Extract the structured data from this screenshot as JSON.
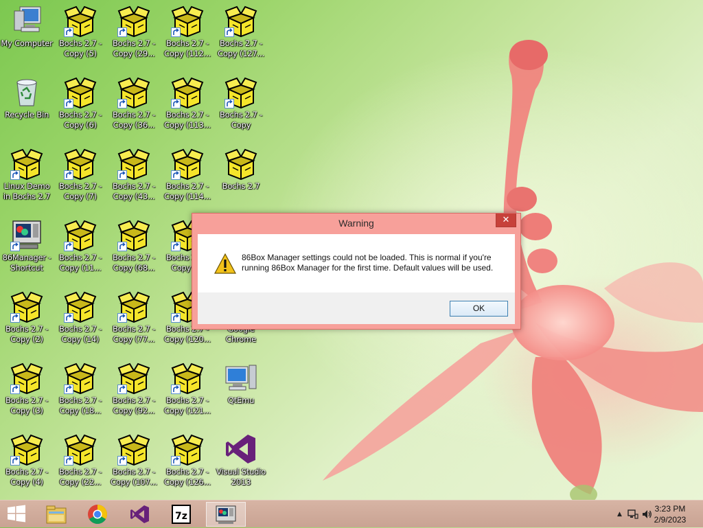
{
  "desktop": {
    "icons": [
      {
        "label": "My Computer",
        "type": "computer",
        "shortcut": false
      },
      {
        "label": "Bochs 2.7 -\nCopy (5)",
        "type": "bochs",
        "shortcut": true
      },
      {
        "label": "Bochs 2.7 -\nCopy (29...",
        "type": "bochs",
        "shortcut": true
      },
      {
        "label": "Bochs 2.7 -\nCopy (112...",
        "type": "bochs",
        "shortcut": true
      },
      {
        "label": "Bochs 2.7 -\nCopy (127...",
        "type": "bochs",
        "shortcut": true
      },
      {
        "label": "Recycle Bin",
        "type": "recycle",
        "shortcut": false
      },
      {
        "label": "Bochs 2.7 -\nCopy (6)",
        "type": "bochs",
        "shortcut": true
      },
      {
        "label": "Bochs 2.7 -\nCopy (36...",
        "type": "bochs",
        "shortcut": true
      },
      {
        "label": "Bochs 2.7 -\nCopy (113...",
        "type": "bochs",
        "shortcut": true
      },
      {
        "label": "Bochs 2.7 -\nCopy",
        "type": "bochs",
        "shortcut": true
      },
      {
        "label": "Linux Demo\nin Bochs 2.7",
        "type": "bochs",
        "shortcut": true
      },
      {
        "label": "Bochs 2.7 -\nCopy (7)",
        "type": "bochs",
        "shortcut": true
      },
      {
        "label": "Bochs 2.7 -\nCopy (43...",
        "type": "bochs",
        "shortcut": true
      },
      {
        "label": "Bochs 2.7 -\nCopy (114...",
        "type": "bochs",
        "shortcut": true
      },
      {
        "label": "Bochs 2.7",
        "type": "bochs",
        "shortcut": false
      },
      {
        "label": "86Manager -\nShortcut",
        "type": "manager",
        "shortcut": true
      },
      {
        "label": "Bochs 2.7 -\nCopy (11...",
        "type": "bochs",
        "shortcut": true
      },
      {
        "label": "Bochs 2.7 -\nCopy (68...",
        "type": "bochs",
        "shortcut": true
      },
      {
        "label": "Bochs 2.7 -\nCopy (...",
        "type": "bochs",
        "shortcut": true
      },
      {
        "label": "Bochs 2.7 -\nCopy (2)",
        "type": "bochs",
        "shortcut": true
      },
      {
        "label": "Bochs 2.7 -\nCopy (14)",
        "type": "bochs",
        "shortcut": true
      },
      {
        "label": "Bochs 2.7 -\nCopy (77...",
        "type": "bochs",
        "shortcut": true
      },
      {
        "label": "Bochs 2.7 -\nCopy (120...",
        "type": "bochs",
        "shortcut": true
      },
      {
        "label": "Google\nChrome",
        "type": "chrome",
        "shortcut": true
      },
      {
        "label": "Bochs 2.7 -\nCopy (3)",
        "type": "bochs",
        "shortcut": true
      },
      {
        "label": "Bochs 2.7 -\nCopy (18...",
        "type": "bochs",
        "shortcut": true
      },
      {
        "label": "Bochs 2.7 -\nCopy (92...",
        "type": "bochs",
        "shortcut": true
      },
      {
        "label": "Bochs 2.7 -\nCopy (121...",
        "type": "bochs",
        "shortcut": true
      },
      {
        "label": "QtEmu",
        "type": "qtemu",
        "shortcut": false
      },
      {
        "label": "Bochs 2.7 -\nCopy (4)",
        "type": "bochs",
        "shortcut": true
      },
      {
        "label": "Bochs 2.7 -\nCopy (22...",
        "type": "bochs",
        "shortcut": true
      },
      {
        "label": "Bochs 2.7 -\nCopy (107...",
        "type": "bochs",
        "shortcut": true
      },
      {
        "label": "Bochs 2.7 -\nCopy (126...",
        "type": "bochs",
        "shortcut": true
      },
      {
        "label": "Visual Studio\n2013",
        "type": "vs",
        "shortcut": false
      }
    ]
  },
  "dialog": {
    "title": "Warning",
    "close_glyph": "✕",
    "icon": "warning-icon",
    "message": "86Box Manager settings could not be loaded. This is normal if you're running 86Box Manager for the first time. Default values will be used.",
    "ok_label": "OK"
  },
  "taskbar": {
    "items": [
      "start-icon",
      "file-explorer-icon",
      "chrome-icon",
      "visual-studio-icon",
      "7zip-icon",
      "86box-manager-icon"
    ],
    "sevenzip_text": "7z",
    "tray_arrow": "▲",
    "clock_time": "3:23 PM",
    "clock_date": "2/9/2023"
  },
  "colors": {
    "dialog_frame": "#f7a09a",
    "close_button": "#c7413a",
    "taskbar": "#c9a393",
    "bochs_box": "#f5e52a"
  }
}
